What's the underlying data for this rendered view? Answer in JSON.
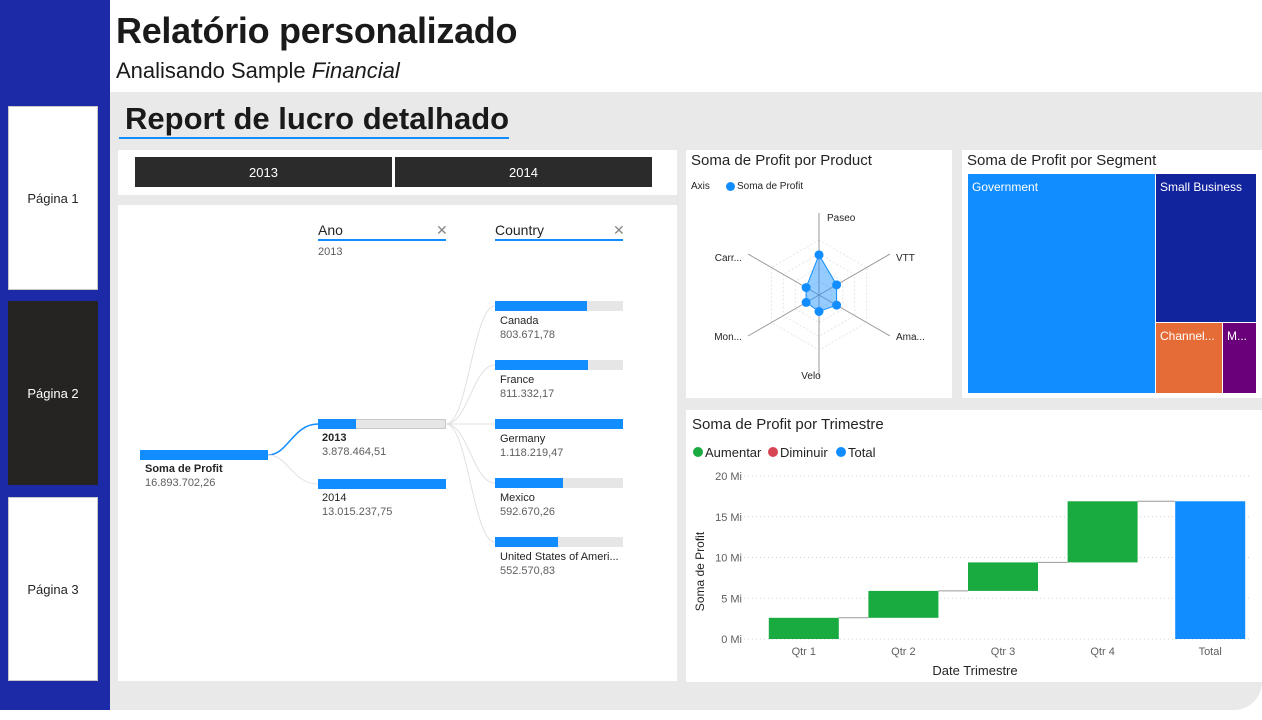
{
  "header": {
    "title": "Relatório personalizado",
    "subtitle_plain": "Analisando Sample ",
    "subtitle_italic": "Financial"
  },
  "nav": {
    "pages": [
      "Página 1",
      "Página 2",
      "Página 3"
    ],
    "active_index": 1
  },
  "report": {
    "title": "Report de lucro detalhado"
  },
  "slicer": {
    "options": [
      "2013",
      "2014"
    ]
  },
  "decomposition_tree": {
    "root": {
      "label": "Soma de Profit",
      "value": "16.893.702,26"
    },
    "levels": [
      {
        "header": "Ano",
        "filter": "2013"
      },
      {
        "header": "Country",
        "filter": ""
      }
    ],
    "years": [
      {
        "label": "2013",
        "value": "3.878.464,51",
        "fill": 0.3,
        "selected": true
      },
      {
        "label": "2014",
        "value": "13.015.237,75",
        "fill": 1.0,
        "selected": false
      }
    ],
    "countries": [
      {
        "label": "Canada",
        "value": "803.671,78",
        "fill": 0.72
      },
      {
        "label": "France",
        "value": "811.332,17",
        "fill": 0.73
      },
      {
        "label": "Germany",
        "value": "1.118.219,47",
        "fill": 1.0
      },
      {
        "label": "Mexico",
        "value": "592.670,26",
        "fill": 0.53
      },
      {
        "label": "United States of Ameri...",
        "value": "552.570,83",
        "fill": 0.49
      }
    ]
  },
  "radar": {
    "title": "Soma de Profit por Product",
    "legend_axis": "Axis",
    "legend_series": "Soma de Profit",
    "colors": {
      "series": "#118dff"
    }
  },
  "treemap": {
    "title": "Soma de Profit por Segment",
    "labels": [
      "Government",
      "Small Business",
      "Channel...",
      "M..."
    ],
    "colors": [
      "#118dff",
      "#12239e",
      "#e66c37",
      "#6b007b"
    ]
  },
  "waterfall": {
    "title": "Soma de Profit por Trimestre",
    "legend": [
      "Aumentar",
      "Diminuir",
      "Total"
    ],
    "legend_colors": [
      "#1aab40",
      "#d64554",
      "#118dff"
    ]
  },
  "chart_data": [
    {
      "type": "radar",
      "title": "Soma de Profit por Product",
      "categories": [
        "Paseo",
        "VTT",
        "Ama...",
        "Velo",
        "Mon...",
        "Carr..."
      ],
      "series": [
        {
          "name": "Soma de Profit",
          "values": [
            0.73,
            0.37,
            0.37,
            0.3,
            0.27,
            0.27
          ]
        }
      ]
    },
    {
      "type": "bar",
      "subtype": "waterfall",
      "title": "Soma de Profit por Trimestre",
      "categories": [
        "Qtr 1",
        "Qtr 2",
        "Qtr 3",
        "Qtr 4",
        "Total"
      ],
      "steps": [
        2.6,
        3.3,
        3.5,
        7.5
      ],
      "total": 16.9,
      "xlabel": "Date Trimestre",
      "ylabel": "Soma de Profit",
      "yticks": [
        "0 Mi",
        "5 Mi",
        "10 Mi",
        "15 Mi",
        "20 Mi"
      ],
      "ylim": [
        0,
        20
      ]
    }
  ]
}
